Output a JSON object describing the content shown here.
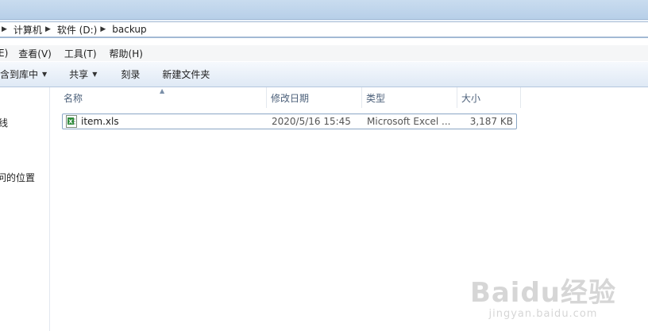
{
  "address": {
    "crumbs": [
      "计算机",
      "软件 (D:)",
      "backup"
    ]
  },
  "menu": {
    "items": [
      "E)",
      "查看(V)",
      "工具(T)",
      "帮助(H)"
    ]
  },
  "toolbar": {
    "include_label": "包含到库中",
    "share_label": "共享",
    "burn_label": "刻录",
    "new_folder_label": "新建文件夹"
  },
  "sidebar": {
    "items": [
      "线",
      "问的位置"
    ]
  },
  "columns": {
    "name": "名称",
    "modified": "修改日期",
    "type": "类型",
    "size": "大小"
  },
  "files": [
    {
      "name": "item.xls",
      "modified": "2020/5/16 15:45",
      "type": "Microsoft Excel ...",
      "size": "3,187 KB",
      "icon": "excel-file-icon"
    }
  ],
  "watermark": {
    "main": "Baidu经验",
    "sub": "jingyan.baidu.com"
  }
}
